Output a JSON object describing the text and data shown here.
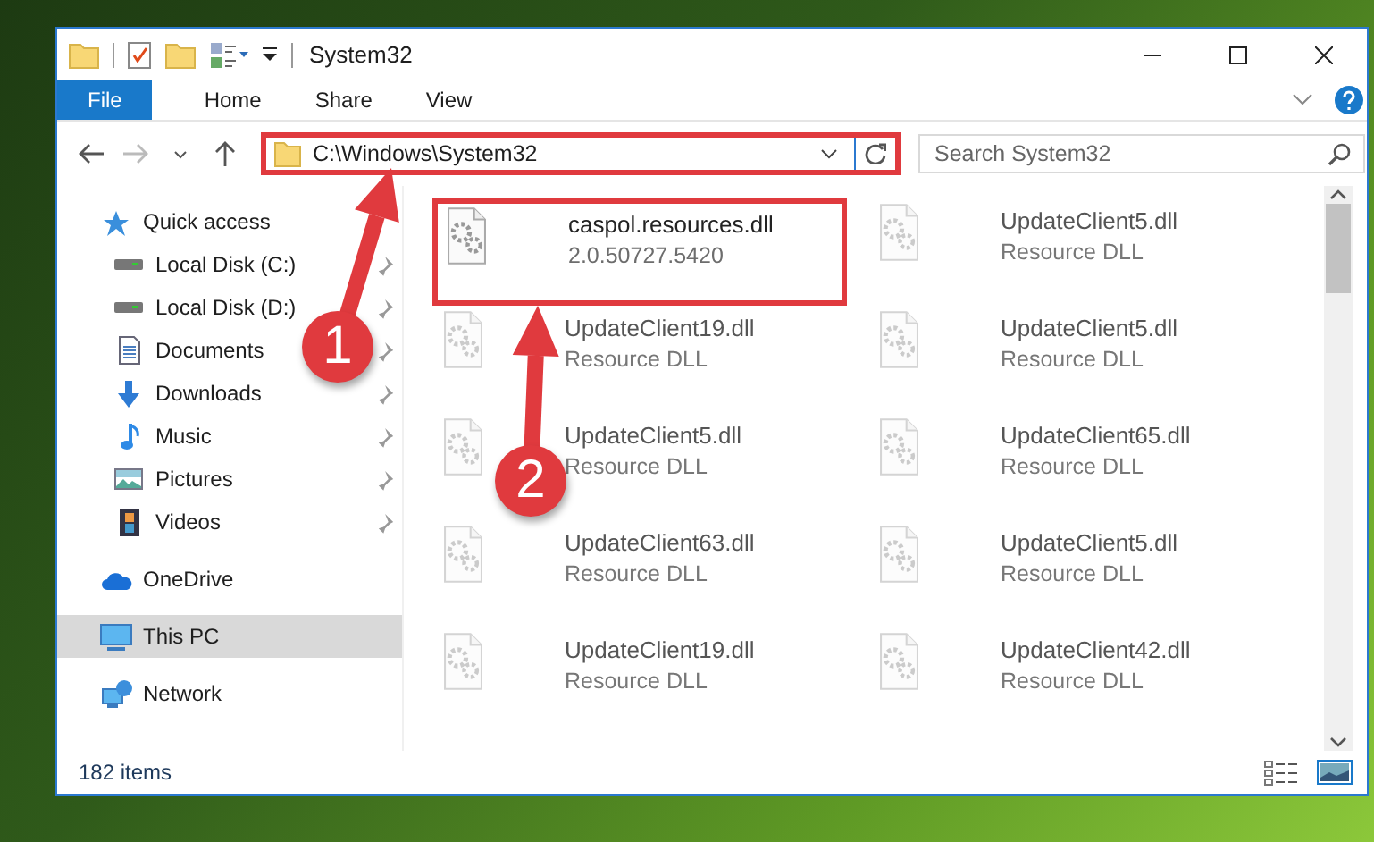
{
  "window": {
    "title": "System32"
  },
  "ribbon_tabs": [
    {
      "label": "File",
      "kind": "file"
    },
    {
      "label": "Home",
      "kind": "tab"
    },
    {
      "label": "Share",
      "kind": "tab"
    },
    {
      "label": "View",
      "kind": "tab"
    }
  ],
  "address_bar": {
    "value": "C:\\Windows\\System32",
    "highlighted": true
  },
  "search": {
    "placeholder": "Search System32"
  },
  "navigation": [
    {
      "label": "Quick access",
      "selected": false,
      "children": [
        {
          "label": "Local Disk (C:)",
          "pinned": true
        },
        {
          "label": "Local Disk (D:)",
          "pinned": true
        },
        {
          "label": "Documents",
          "pinned": true
        },
        {
          "label": "Downloads",
          "pinned": true
        },
        {
          "label": "Music",
          "pinned": true
        },
        {
          "label": "Pictures",
          "pinned": true
        },
        {
          "label": "Videos",
          "pinned": true
        }
      ]
    },
    {
      "label": "OneDrive",
      "selected": false
    },
    {
      "label": "This PC",
      "selected": true
    },
    {
      "label": "Network",
      "selected": false
    }
  ],
  "files": [
    {
      "name": "caspol.resources.dll",
      "detail": "2.0.50727.5420",
      "blurred": false,
      "highlighted": true
    },
    {
      "name": "UpdateClient5.dll",
      "detail": "Resource DLL",
      "blurred": true,
      "highlighted": false
    },
    {
      "name": "UpdateClient19.dll",
      "detail": "Resource DLL",
      "blurred": true,
      "highlighted": false
    },
    {
      "name": "UpdateClient5.dll",
      "detail": "Resource DLL",
      "blurred": true,
      "highlighted": false
    },
    {
      "name": "UpdateClient5.dll",
      "detail": "Resource DLL",
      "blurred": true,
      "highlighted": false
    },
    {
      "name": "UpdateClient65.dll",
      "detail": "Resource DLL",
      "blurred": true,
      "highlighted": false
    },
    {
      "name": "UpdateClient63.dll",
      "detail": "Resource DLL",
      "blurred": true,
      "highlighted": false
    },
    {
      "name": "UpdateClient5.dll",
      "detail": "Resource DLL",
      "blurred": true,
      "highlighted": false
    },
    {
      "name": "UpdateClient19.dll",
      "detail": "Resource DLL",
      "blurred": true,
      "highlighted": false
    },
    {
      "name": "UpdateClient42.dll",
      "detail": "Resource DLL",
      "blurred": true,
      "highlighted": false
    }
  ],
  "status_bar": {
    "item_count": "182 items"
  },
  "annotations": [
    {
      "number": "1"
    },
    {
      "number": "2"
    }
  ]
}
